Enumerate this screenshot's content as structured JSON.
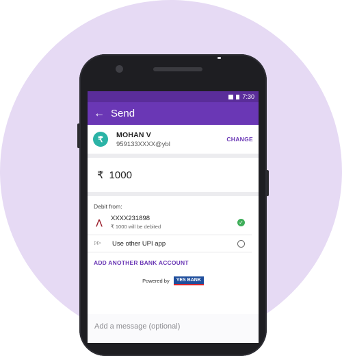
{
  "status_bar": {
    "time": "7:30"
  },
  "app_bar": {
    "back_icon": "back-arrow-icon",
    "title": "Send"
  },
  "payee": {
    "avatar_symbol": "₹",
    "name": "MOHAN V",
    "vpa": "959133XXXX@ybl",
    "change_label": "CHANGE"
  },
  "amount": {
    "symbol": "₹",
    "value": "1000"
  },
  "debit": {
    "label": "Debit from:",
    "accounts": [
      {
        "number": "XXXX231898",
        "sub": "₹ 1000 will be debited",
        "selected": true
      },
      {
        "number": "Use other UPI app",
        "selected": false
      }
    ],
    "add_bank_label": "ADD ANOTHER BANK ACCOUNT",
    "powered_by": "Powered by",
    "bank_logo_text": "YES BANK"
  },
  "message": {
    "placeholder": "Add a message (optional)"
  },
  "colors": {
    "primary": "#6a37b5",
    "status": "#5a2d9a",
    "avatar": "#2bb3a6",
    "check": "#3fae5a",
    "background_circle": "#e6daf4"
  }
}
